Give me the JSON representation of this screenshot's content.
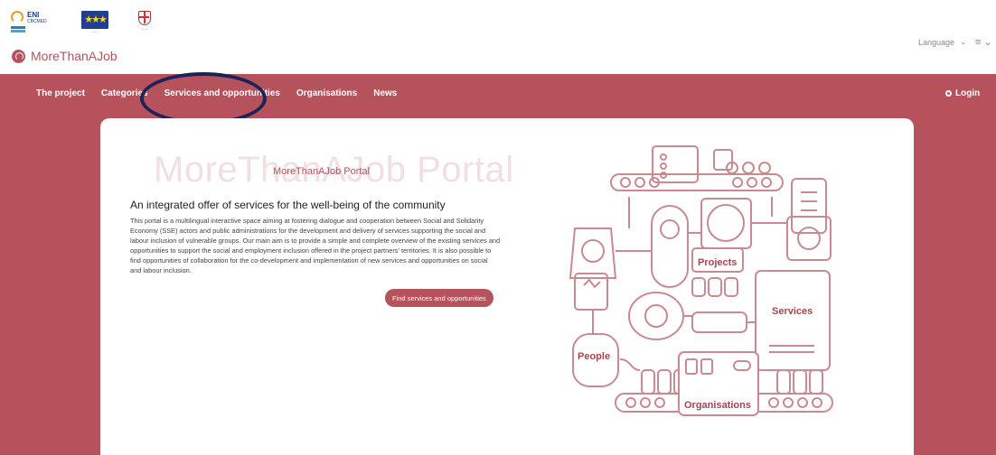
{
  "header": {
    "logos": {
      "eni": {
        "text": "ENI",
        "sub": "CBCMED"
      },
      "eu": {
        "stars": "★★★"
      }
    },
    "brand": {
      "name": "MoreThanAJob"
    },
    "language_label": "Language",
    "menu_icon": "hamburger-icon"
  },
  "nav": {
    "items": [
      {
        "label": "The project"
      },
      {
        "label": "Categories"
      },
      {
        "label": "Services and opportunities"
      },
      {
        "label": "Organisations"
      },
      {
        "label": "News"
      }
    ],
    "login": "Login"
  },
  "hero": {
    "ghost_title": "MoreThanAJob Portal",
    "portal_title": "MoreThanAJob Portal",
    "headline": "An integrated offer of services for the well-being of the community",
    "paragraph": "This portal is a multilingual interactive space aiming at fostering dialogue and cooperation between Social and Solidarity Economy (SSE) actors and public administrations for the development and delivery of services supporting the social and labour inclusion of vulnerable groups. Our main aim is to provide a simple and complete overview of the existing services and opportunities to support the social and employment inclusion offered in the project partners' territories. It is also possible to find opportunities of collaboration for the co-development and implementation of new services and opportunities on social and labour inclusion.",
    "cta": "Find services and opportunities"
  },
  "illustration": {
    "labels": {
      "projects": "Projects",
      "services": "Services",
      "people": "People",
      "organisations": "Organisations"
    }
  },
  "colors": {
    "brand": "#b5525c",
    "highlight": "#1b2458"
  }
}
